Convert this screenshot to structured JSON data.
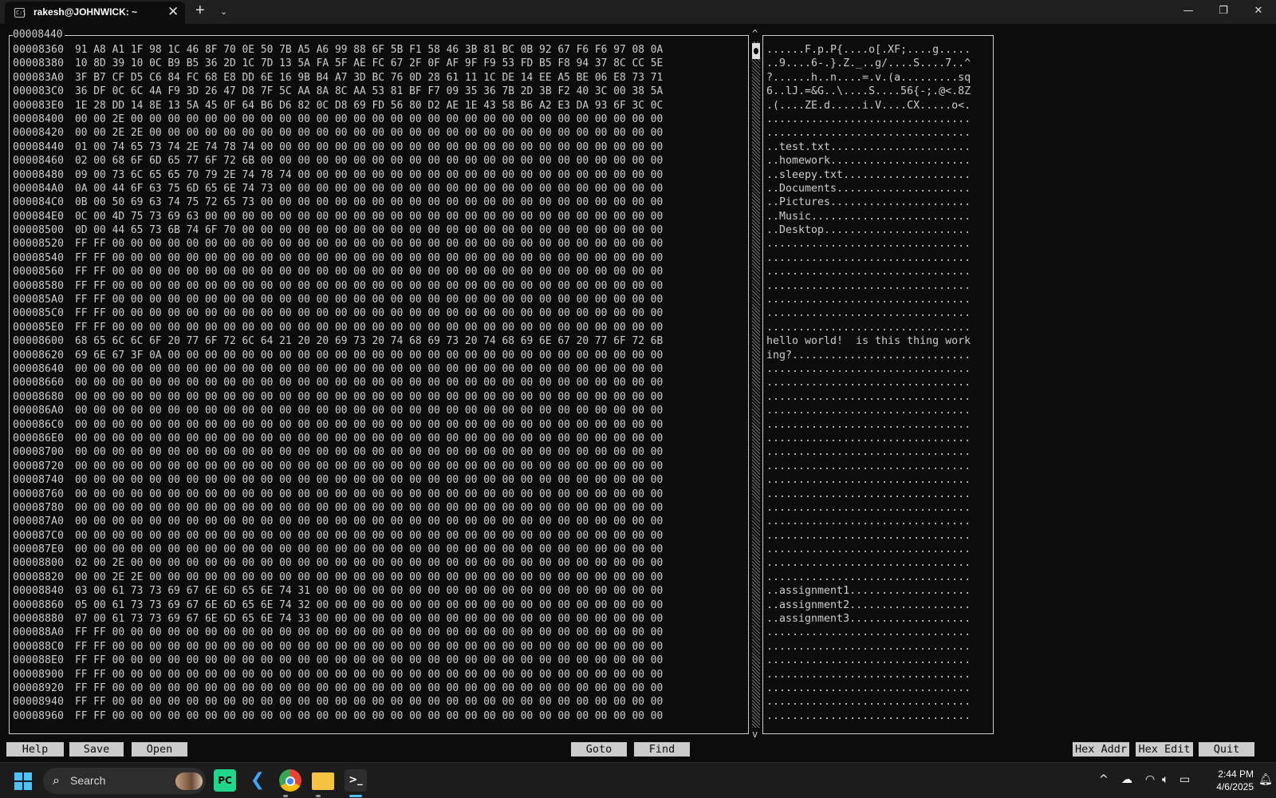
{
  "window": {
    "tab_title": "rakesh@JOHNWICK: ~",
    "tab_icon": "terminal-icon",
    "new_tab": "+",
    "dropdown": "⌄",
    "close_tab": "✕",
    "minimize": "—",
    "maximize": "❐",
    "close": "✕"
  },
  "editor": {
    "current_address": "00008440",
    "hex_rows": [
      {
        "addr": "00008360",
        "bytes": "91 A8 A1 1F 98 1C 46 8F 70 0E 50 7B A5 A6 99 88 6F 5B F1 58 46 3B 81 BC 0B 92 67 F6 F6 97 08 0A"
      },
      {
        "addr": "00008380",
        "bytes": "10 8D 39 10 0C B9 B5 36 2D 1C 7D 13 5A FA 5F AE FC 67 2F 0F AF 9F F9 53 FD B5 F8 94 37 8C CC 5E"
      },
      {
        "addr": "000083A0",
        "bytes": "3F B7 CF D5 C6 84 FC 68 E8 DD 6E 16 9B B4 A7 3D BC 76 0D 28 61 11 1C DE 14 EE A5 BE 06 E8 73 71"
      },
      {
        "addr": "000083C0",
        "bytes": "36 DF 0C 6C 4A F9 3D 26 47 D8 7F 5C AA 8A 8C AA 53 81 BF F7 09 35 36 7B 2D 3B F2 40 3C 00 38 5A"
      },
      {
        "addr": "000083E0",
        "bytes": "1E 28 DD 14 8E 13 5A 45 0F 64 B6 D6 82 0C D8 69 FD 56 80 D2 AE 1E 43 58 B6 A2 E3 DA 93 6F 3C 0C"
      },
      {
        "addr": "00008400",
        "bytes": "00 00 2E 00 00 00 00 00 00 00 00 00 00 00 00 00 00 00 00 00 00 00 00 00 00 00 00 00 00 00 00 00"
      },
      {
        "addr": "00008420",
        "bytes": "00 00 2E 2E 00 00 00 00 00 00 00 00 00 00 00 00 00 00 00 00 00 00 00 00 00 00 00 00 00 00 00 00"
      },
      {
        "addr": "00008440",
        "bytes": "01 00 74 65 73 74 2E 74 78 74 00 00 00 00 00 00 00 00 00 00 00 00 00 00 00 00 00 00 00 00 00 00"
      },
      {
        "addr": "00008460",
        "bytes": "02 00 68 6F 6D 65 77 6F 72 6B 00 00 00 00 00 00 00 00 00 00 00 00 00 00 00 00 00 00 00 00 00 00"
      },
      {
        "addr": "00008480",
        "bytes": "09 00 73 6C 65 65 70 79 2E 74 78 74 00 00 00 00 00 00 00 00 00 00 00 00 00 00 00 00 00 00 00 00"
      },
      {
        "addr": "000084A0",
        "bytes": "0A 00 44 6F 63 75 6D 65 6E 74 73 00 00 00 00 00 00 00 00 00 00 00 00 00 00 00 00 00 00 00 00 00"
      },
      {
        "addr": "000084C0",
        "bytes": "0B 00 50 69 63 74 75 72 65 73 00 00 00 00 00 00 00 00 00 00 00 00 00 00 00 00 00 00 00 00 00 00"
      },
      {
        "addr": "000084E0",
        "bytes": "0C 00 4D 75 73 69 63 00 00 00 00 00 00 00 00 00 00 00 00 00 00 00 00 00 00 00 00 00 00 00 00 00"
      },
      {
        "addr": "00008500",
        "bytes": "0D 00 44 65 73 6B 74 6F 70 00 00 00 00 00 00 00 00 00 00 00 00 00 00 00 00 00 00 00 00 00 00 00"
      },
      {
        "addr": "00008520",
        "bytes": "FF FF 00 00 00 00 00 00 00 00 00 00 00 00 00 00 00 00 00 00 00 00 00 00 00 00 00 00 00 00 00 00"
      },
      {
        "addr": "00008540",
        "bytes": "FF FF 00 00 00 00 00 00 00 00 00 00 00 00 00 00 00 00 00 00 00 00 00 00 00 00 00 00 00 00 00 00"
      },
      {
        "addr": "00008560",
        "bytes": "FF FF 00 00 00 00 00 00 00 00 00 00 00 00 00 00 00 00 00 00 00 00 00 00 00 00 00 00 00 00 00 00"
      },
      {
        "addr": "00008580",
        "bytes": "FF FF 00 00 00 00 00 00 00 00 00 00 00 00 00 00 00 00 00 00 00 00 00 00 00 00 00 00 00 00 00 00"
      },
      {
        "addr": "000085A0",
        "bytes": "FF FF 00 00 00 00 00 00 00 00 00 00 00 00 00 00 00 00 00 00 00 00 00 00 00 00 00 00 00 00 00 00"
      },
      {
        "addr": "000085C0",
        "bytes": "FF FF 00 00 00 00 00 00 00 00 00 00 00 00 00 00 00 00 00 00 00 00 00 00 00 00 00 00 00 00 00 00"
      },
      {
        "addr": "000085E0",
        "bytes": "FF FF 00 00 00 00 00 00 00 00 00 00 00 00 00 00 00 00 00 00 00 00 00 00 00 00 00 00 00 00 00 00"
      },
      {
        "addr": "00008600",
        "bytes": "68 65 6C 6C 6F 20 77 6F 72 6C 64 21 20 20 69 73 20 74 68 69 73 20 74 68 69 6E 67 20 77 6F 72 6B"
      },
      {
        "addr": "00008620",
        "bytes": "69 6E 67 3F 0A 00 00 00 00 00 00 00 00 00 00 00 00 00 00 00 00 00 00 00 00 00 00 00 00 00 00 00"
      },
      {
        "addr": "00008640",
        "bytes": "00 00 00 00 00 00 00 00 00 00 00 00 00 00 00 00 00 00 00 00 00 00 00 00 00 00 00 00 00 00 00 00"
      },
      {
        "addr": "00008660",
        "bytes": "00 00 00 00 00 00 00 00 00 00 00 00 00 00 00 00 00 00 00 00 00 00 00 00 00 00 00 00 00 00 00 00"
      },
      {
        "addr": "00008680",
        "bytes": "00 00 00 00 00 00 00 00 00 00 00 00 00 00 00 00 00 00 00 00 00 00 00 00 00 00 00 00 00 00 00 00"
      },
      {
        "addr": "000086A0",
        "bytes": "00 00 00 00 00 00 00 00 00 00 00 00 00 00 00 00 00 00 00 00 00 00 00 00 00 00 00 00 00 00 00 00"
      },
      {
        "addr": "000086C0",
        "bytes": "00 00 00 00 00 00 00 00 00 00 00 00 00 00 00 00 00 00 00 00 00 00 00 00 00 00 00 00 00 00 00 00"
      },
      {
        "addr": "000086E0",
        "bytes": "00 00 00 00 00 00 00 00 00 00 00 00 00 00 00 00 00 00 00 00 00 00 00 00 00 00 00 00 00 00 00 00"
      },
      {
        "addr": "00008700",
        "bytes": "00 00 00 00 00 00 00 00 00 00 00 00 00 00 00 00 00 00 00 00 00 00 00 00 00 00 00 00 00 00 00 00"
      },
      {
        "addr": "00008720",
        "bytes": "00 00 00 00 00 00 00 00 00 00 00 00 00 00 00 00 00 00 00 00 00 00 00 00 00 00 00 00 00 00 00 00"
      },
      {
        "addr": "00008740",
        "bytes": "00 00 00 00 00 00 00 00 00 00 00 00 00 00 00 00 00 00 00 00 00 00 00 00 00 00 00 00 00 00 00 00"
      },
      {
        "addr": "00008760",
        "bytes": "00 00 00 00 00 00 00 00 00 00 00 00 00 00 00 00 00 00 00 00 00 00 00 00 00 00 00 00 00 00 00 00"
      },
      {
        "addr": "00008780",
        "bytes": "00 00 00 00 00 00 00 00 00 00 00 00 00 00 00 00 00 00 00 00 00 00 00 00 00 00 00 00 00 00 00 00"
      },
      {
        "addr": "000087A0",
        "bytes": "00 00 00 00 00 00 00 00 00 00 00 00 00 00 00 00 00 00 00 00 00 00 00 00 00 00 00 00 00 00 00 00"
      },
      {
        "addr": "000087C0",
        "bytes": "00 00 00 00 00 00 00 00 00 00 00 00 00 00 00 00 00 00 00 00 00 00 00 00 00 00 00 00 00 00 00 00"
      },
      {
        "addr": "000087E0",
        "bytes": "00 00 00 00 00 00 00 00 00 00 00 00 00 00 00 00 00 00 00 00 00 00 00 00 00 00 00 00 00 00 00 00"
      },
      {
        "addr": "00008800",
        "bytes": "02 00 2E 00 00 00 00 00 00 00 00 00 00 00 00 00 00 00 00 00 00 00 00 00 00 00 00 00 00 00 00 00"
      },
      {
        "addr": "00008820",
        "bytes": "00 00 2E 2E 00 00 00 00 00 00 00 00 00 00 00 00 00 00 00 00 00 00 00 00 00 00 00 00 00 00 00 00"
      },
      {
        "addr": "00008840",
        "bytes": "03 00 61 73 73 69 67 6E 6D 65 6E 74 31 00 00 00 00 00 00 00 00 00 00 00 00 00 00 00 00 00 00 00"
      },
      {
        "addr": "00008860",
        "bytes": "05 00 61 73 73 69 67 6E 6D 65 6E 74 32 00 00 00 00 00 00 00 00 00 00 00 00 00 00 00 00 00 00 00"
      },
      {
        "addr": "00008880",
        "bytes": "07 00 61 73 73 69 67 6E 6D 65 6E 74 33 00 00 00 00 00 00 00 00 00 00 00 00 00 00 00 00 00 00 00"
      },
      {
        "addr": "000088A0",
        "bytes": "FF FF 00 00 00 00 00 00 00 00 00 00 00 00 00 00 00 00 00 00 00 00 00 00 00 00 00 00 00 00 00 00"
      },
      {
        "addr": "000088C0",
        "bytes": "FF FF 00 00 00 00 00 00 00 00 00 00 00 00 00 00 00 00 00 00 00 00 00 00 00 00 00 00 00 00 00 00"
      },
      {
        "addr": "000088E0",
        "bytes": "FF FF 00 00 00 00 00 00 00 00 00 00 00 00 00 00 00 00 00 00 00 00 00 00 00 00 00 00 00 00 00 00"
      },
      {
        "addr": "00008900",
        "bytes": "FF FF 00 00 00 00 00 00 00 00 00 00 00 00 00 00 00 00 00 00 00 00 00 00 00 00 00 00 00 00 00 00"
      },
      {
        "addr": "00008920",
        "bytes": "FF FF 00 00 00 00 00 00 00 00 00 00 00 00 00 00 00 00 00 00 00 00 00 00 00 00 00 00 00 00 00 00"
      },
      {
        "addr": "00008940",
        "bytes": "FF FF 00 00 00 00 00 00 00 00 00 00 00 00 00 00 00 00 00 00 00 00 00 00 00 00 00 00 00 00 00 00"
      },
      {
        "addr": "00008960",
        "bytes": "FF FF 00 00 00 00 00 00 00 00 00 00 00 00 00 00 00 00 00 00 00 00 00 00 00 00 00 00 00 00 00 00"
      }
    ],
    "ascii_rows": [
      "......F.p.P{....o[.XF;....g.....",
      "..9....6-.}.Z._..g/....S....7..^",
      "?......h..n....=.v.(a.........sq",
      "6..lJ.=&G..\\....S....56{-;.@<.8Z",
      ".(....ZE.d.....i.V....CX.....o<.",
      "................................",
      "................................",
      "..test.txt......................",
      "..homework......................",
      "..sleepy.txt....................",
      "..Documents.....................",
      "..Pictures......................",
      "..Music.........................",
      "..Desktop.......................",
      "................................",
      "................................",
      "................................",
      "................................",
      "................................",
      "................................",
      "................................",
      "hello world!  is this thing work",
      "ing?............................",
      "................................",
      "................................",
      "................................",
      "................................",
      "................................",
      "................................",
      "................................",
      "................................",
      "................................",
      "................................",
      "................................",
      "................................",
      "................................",
      "................................",
      "................................",
      "................................",
      "..assignment1...................",
      "..assignment2...................",
      "..assignment3...................",
      "................................",
      "................................",
      "................................",
      "................................",
      "................................",
      "................................",
      "................................"
    ],
    "scroll_up": "^",
    "scroll_down": "v"
  },
  "function_keys": {
    "help": "Help",
    "save": "Save",
    "open": "Open",
    "goto": "Goto",
    "find": "Find",
    "hex_addr": "Hex Addr",
    "hex_edit": "Hex Edit",
    "quit": "Quit"
  },
  "taskbar": {
    "search_placeholder": "Search",
    "search_icon": "⌕",
    "apps": [
      "PyCharm",
      "Visual Studio Code",
      "Chrome",
      "File Explorer",
      "Terminal"
    ],
    "tray_chevron": "^",
    "time": "2:44 PM",
    "date": "4/6/2025"
  },
  "colors": {
    "terminal_bg": "#0c0c0c",
    "terminal_fg": "#cccccc",
    "titlebar_bg": "#1f1f1f",
    "taskbar_bg": "#1c1c1c",
    "accent": "#4cc2ff"
  }
}
